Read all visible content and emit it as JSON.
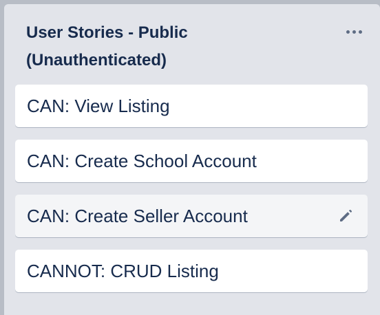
{
  "list": {
    "title_line1": "User Stories - Public",
    "title_line2": "(Unauthenticated)",
    "menu_icon": "more-horizontal-icon",
    "cards": [
      {
        "title": "CAN: View Listing"
      },
      {
        "title": "CAN: Create School Account"
      },
      {
        "title": "CAN: Create Seller Account",
        "hovered": true,
        "edit_icon": "pencil-icon"
      },
      {
        "title": "CANNOT: CRUD Listing"
      }
    ]
  },
  "colors": {
    "list_bg": "#e2e4ea",
    "card_bg": "#ffffff",
    "card_hover_bg": "#f4f5f7",
    "title_text": "#172b4d",
    "icon": "#5e6c84"
  }
}
